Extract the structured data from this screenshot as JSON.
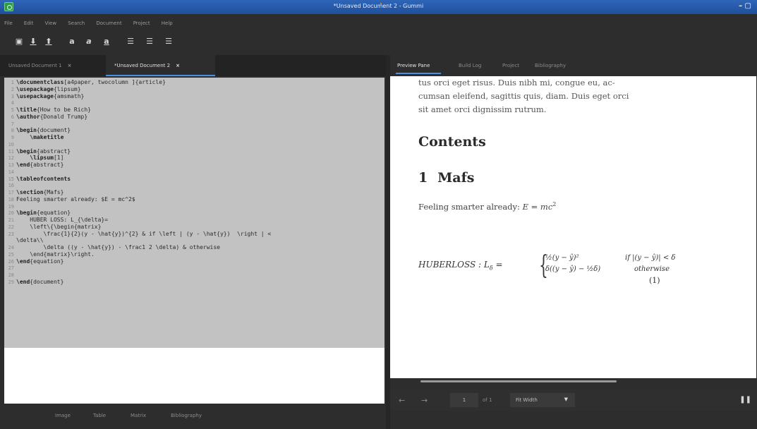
{
  "window": {
    "title": "*Unsaved Document 2 - Gummi",
    "controls": "– ▢"
  },
  "menu": [
    "File",
    "Edit",
    "View",
    "Search",
    "Document",
    "Project",
    "Help"
  ],
  "toolbar": {
    "icons": [
      "new-file-icon",
      "download-icon",
      "upload-icon",
      "bold-icon",
      "italic-icon",
      "underline-icon",
      "align-left-icon",
      "align-center-icon",
      "align-right-icon"
    ]
  },
  "editor": {
    "tabs": [
      {
        "label": "Unsaved Document 1",
        "close": "×"
      },
      {
        "label": "*Unsaved Document 2",
        "close": "×"
      }
    ],
    "lines": [
      {
        "n": "1",
        "kw": "\\documentclass",
        "rest": "[a4paper, twocolumn ]{article}"
      },
      {
        "n": "2",
        "kw": "\\usepackage",
        "rest": "{lipsum}"
      },
      {
        "n": "3",
        "kw": "\\usepackage",
        "rest": "{amsmath}"
      },
      {
        "n": "4",
        "kw": "",
        "rest": ""
      },
      {
        "n": "5",
        "kw": "\\title",
        "rest": "{How to be Rich}"
      },
      {
        "n": "6",
        "kw": "\\author",
        "rest": "{Donald Trump}"
      },
      {
        "n": "7",
        "kw": "",
        "rest": ""
      },
      {
        "n": "8",
        "kw": "\\begin",
        "rest": "{document}"
      },
      {
        "n": "9",
        "kw": "    \\maketitle",
        "rest": ""
      },
      {
        "n": "10",
        "kw": "",
        "rest": ""
      },
      {
        "n": "11",
        "kw": "\\begin",
        "rest": "{abstract}"
      },
      {
        "n": "12",
        "kw": "    \\lipsum",
        "rest": "[1]"
      },
      {
        "n": "13",
        "kw": "\\end",
        "rest": "{abstract}"
      },
      {
        "n": "14",
        "kw": "",
        "rest": ""
      },
      {
        "n": "15",
        "kw": "\\tableofcontents",
        "rest": ""
      },
      {
        "n": "16",
        "kw": "",
        "rest": ""
      },
      {
        "n": "17",
        "kw": "\\section",
        "rest": "{Mafs}"
      },
      {
        "n": "18",
        "kw": "",
        "rest": "Feeling smarter already: $E = mc^2$"
      },
      {
        "n": "19",
        "kw": "",
        "rest": ""
      },
      {
        "n": "20",
        "kw": "\\begin",
        "rest": "{equation}"
      },
      {
        "n": "21",
        "kw": "",
        "rest": "    HUBER LOSS: L_{\\delta}="
      },
      {
        "n": "22",
        "kw": "",
        "rest": "    \\left\\{\\begin{matrix}"
      },
      {
        "n": "23",
        "kw": "",
        "rest": "        \\frac{1}{2}(y - \\hat{y})^{2} & if \\left | (y - \\hat{y})  \\right | <"
      },
      {
        "n": "",
        "kw": "",
        "rest": "\\delta\\\\"
      },
      {
        "n": "24",
        "kw": "",
        "rest": "        \\delta ((y - \\hat{y}) - \\frac1 2 \\delta) & otherwise"
      },
      {
        "n": "25",
        "kw": "",
        "rest": "    \\end{matrix}\\right."
      },
      {
        "n": "26",
        "kw": "\\end",
        "rest": "{equation}"
      },
      {
        "n": "27",
        "kw": "",
        "rest": ""
      },
      {
        "n": "28",
        "kw": "",
        "rest": ""
      },
      {
        "n": "29",
        "kw": "\\end",
        "rest": "{document}"
      }
    ],
    "bottom_buttons": [
      "Image",
      "Table",
      "Matrix",
      "Bibliography"
    ]
  },
  "preview": {
    "tabs": [
      "Preview Pane",
      "Build Log",
      "Project",
      "Bibliography"
    ],
    "text_lines": [
      "tus orci eget risus. Duis nibh mi, congue eu, ac-",
      "cumsan eleifend, sagittis quis, diam. Duis eget orci",
      "sit amet orci dignissim rutrum."
    ],
    "contents_heading": "Contents",
    "section_number": "1",
    "section_title": "Mafs",
    "feeling_text": "Feeling smarter already: ",
    "feeling_math": "E = mc",
    "feeling_sup": "2",
    "eq_lhs": "HUBERLOSS : L",
    "eq_lhs_sub": "δ",
    "eq_lhs_eq": " =",
    "eq_row1_a": "½(y − ŷ)²",
    "eq_row1_b": "if |(y − ŷ)| < δ",
    "eq_row2_a": "δ((y − ŷ) − ½δ)",
    "eq_row2_b": "otherwise",
    "eq_number": "(1)",
    "page_current": "1",
    "page_of": "of 1",
    "zoom": "Fit Width",
    "nav_prev": "←",
    "nav_next": "→",
    "pause": "❚❚"
  }
}
